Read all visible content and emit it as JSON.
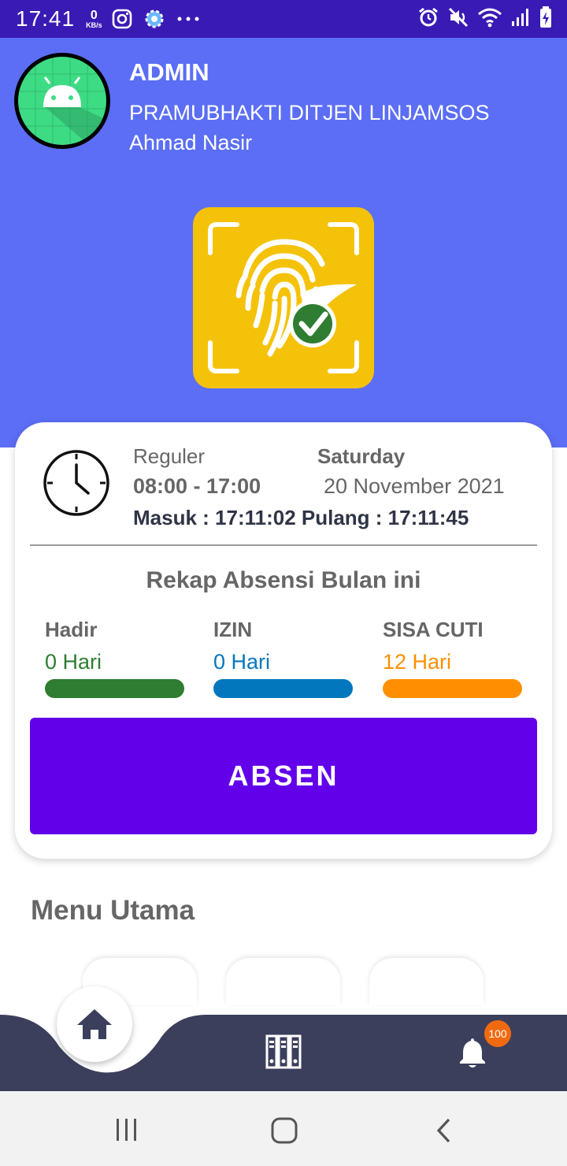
{
  "status_bar": {
    "time": "17:41",
    "net_speed_value": "0",
    "net_speed_unit": "KB/s"
  },
  "header": {
    "role": "ADMIN",
    "organization": "PRAMUBHAKTI DITJEN LINJAMSOS",
    "user_name": "Ahmad Nasir"
  },
  "schedule": {
    "shift": "Reguler",
    "hours": "08:00 - 17:00",
    "day": "Saturday",
    "date": "20 November 2021",
    "check_in_out": "Masuk : 17:11:02 Pulang : 17:11:45"
  },
  "recap": {
    "title": "Rekap Absensi Bulan ini",
    "items": [
      {
        "label": "Hadir",
        "value": "0 Hari",
        "color": "#2e7d32"
      },
      {
        "label": "IZIN",
        "value": "0 Hari",
        "color": "#0277bd"
      },
      {
        "label": "SISA CUTI",
        "value": "12 Hari",
        "color": "#ff8f00"
      }
    ]
  },
  "actions": {
    "absen_label": "ABSEN"
  },
  "menu": {
    "title": "Menu Utama"
  },
  "bottom_nav": {
    "notification_count": "100"
  },
  "colors": {
    "status_bar": "#3a1ab4",
    "header": "#5b6ef5",
    "primary_button": "#6200ea",
    "bottom_nav": "#3b3f5c",
    "fingerprint_tile": "#f5c20a"
  }
}
